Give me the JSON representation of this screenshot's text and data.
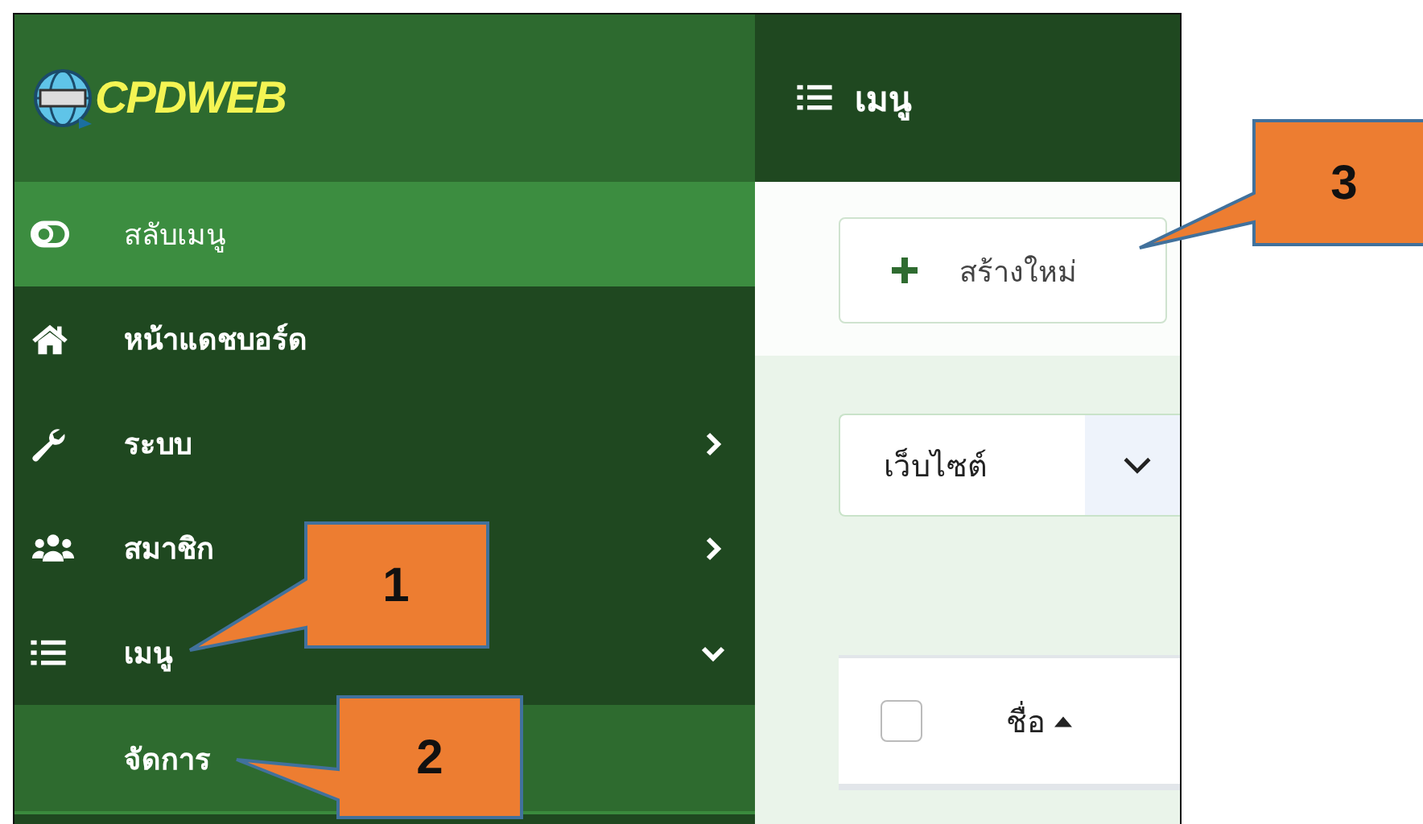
{
  "logo": {
    "text": "CPDWEB"
  },
  "sidebar": {
    "items": [
      {
        "kind": "toggle",
        "label": "สลับเมนู",
        "selected": true
      },
      {
        "kind": "home",
        "label": "หน้าแดชบอร์ด",
        "selected": false
      },
      {
        "kind": "wrench",
        "label": "ระบบ",
        "selected": false,
        "expanded": false
      },
      {
        "kind": "users",
        "label": "สมาชิก",
        "selected": false,
        "expanded": false
      },
      {
        "kind": "list",
        "label": "เมนู",
        "selected": false,
        "expanded": true,
        "children": [
          {
            "label": "จัดการ",
            "selected": true
          }
        ]
      }
    ]
  },
  "header": {
    "title": "เมนู"
  },
  "toolbar": {
    "button": "สร้างใหม่"
  },
  "filter": {
    "value": "เว็บไซต์"
  },
  "table": {
    "select_all": {
      "checked": false
    },
    "columns": [
      {
        "label": "ชื่อ",
        "sort_ascending": true
      }
    ]
  },
  "callouts": [
    {
      "label": "1"
    },
    {
      "label": "2"
    },
    {
      "label": "3"
    }
  ]
}
